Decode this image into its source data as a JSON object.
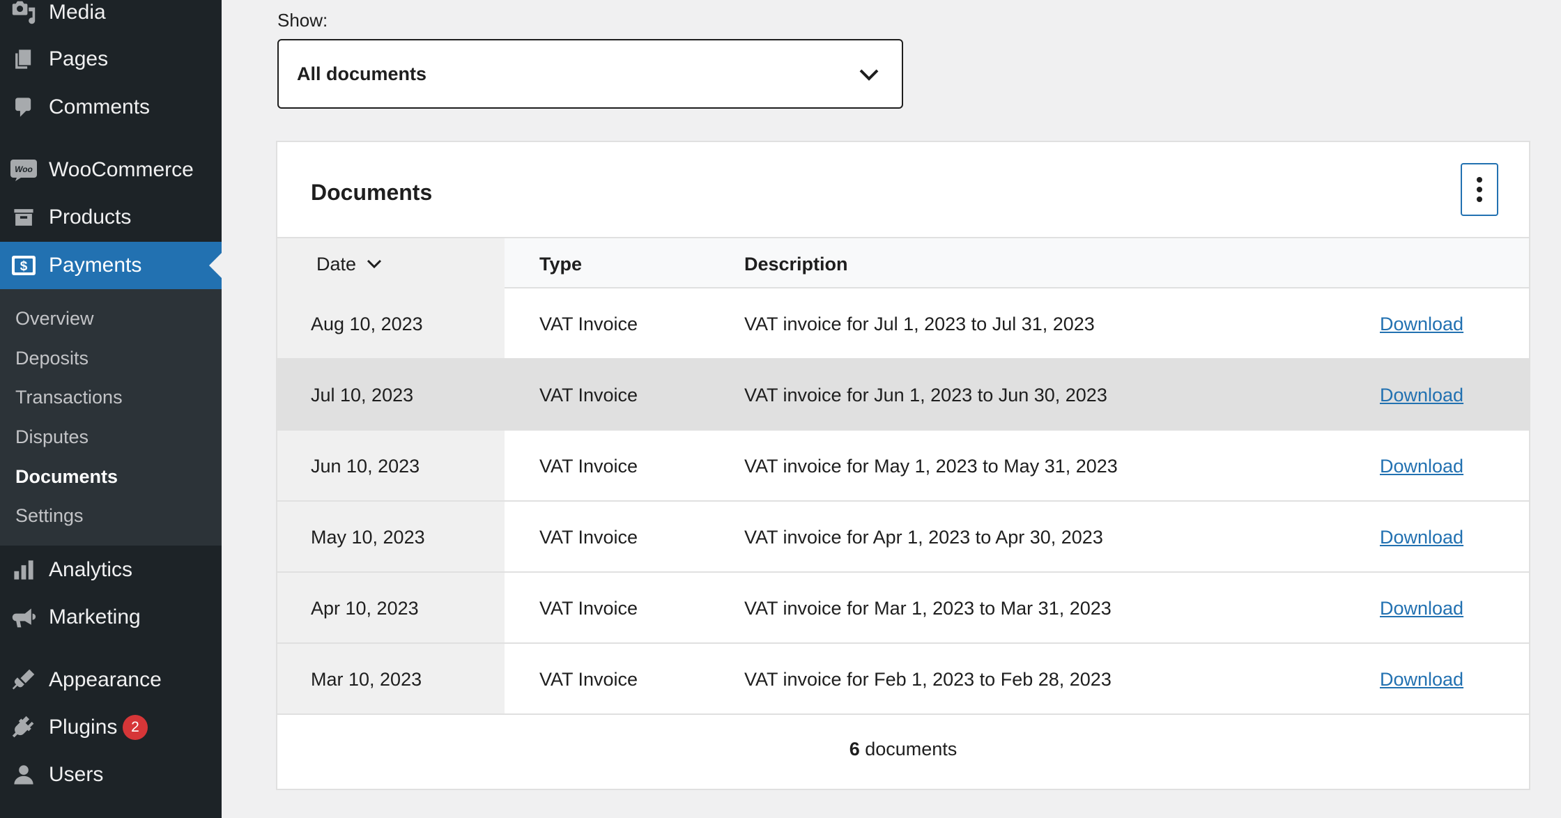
{
  "sidebar": {
    "top_items": [
      {
        "label": "Media",
        "icon": "media-icon"
      },
      {
        "label": "Pages",
        "icon": "pages-icon"
      },
      {
        "label": "Comments",
        "icon": "comments-icon"
      },
      {
        "label": "WooCommerce",
        "icon": "woocommerce-icon"
      },
      {
        "label": "Products",
        "icon": "products-icon"
      },
      {
        "label": "Payments",
        "icon": "payments-icon"
      }
    ],
    "submenu": [
      "Overview",
      "Deposits",
      "Transactions",
      "Disputes",
      "Documents",
      "Settings"
    ],
    "current_submenu": "Documents",
    "bottom_items": [
      {
        "label": "Analytics",
        "icon": "analytics-icon"
      },
      {
        "label": "Marketing",
        "icon": "marketing-icon"
      },
      {
        "label": "Appearance",
        "icon": "appearance-icon"
      },
      {
        "label": "Plugins",
        "icon": "plugins-icon",
        "badge": "2"
      },
      {
        "label": "Users",
        "icon": "users-icon"
      }
    ]
  },
  "filter": {
    "label": "Show:",
    "selected": "All documents"
  },
  "documents": {
    "title": "Documents",
    "columns": {
      "date": "Date",
      "type": "Type",
      "description": "Description"
    },
    "rows": [
      {
        "date": "Aug 10, 2023",
        "type": "VAT Invoice",
        "description": "VAT invoice for Jul 1, 2023 to Jul 31, 2023",
        "action": "Download"
      },
      {
        "date": "Jul 10, 2023",
        "type": "VAT Invoice",
        "description": "VAT invoice for Jun 1, 2023 to Jun 30, 2023",
        "action": "Download"
      },
      {
        "date": "Jun 10, 2023",
        "type": "VAT Invoice",
        "description": "VAT invoice for May 1, 2023 to May 31, 2023",
        "action": "Download"
      },
      {
        "date": "May 10, 2023",
        "type": "VAT Invoice",
        "description": "VAT invoice for Apr 1, 2023 to Apr 30, 2023",
        "action": "Download"
      },
      {
        "date": "Apr 10, 2023",
        "type": "VAT Invoice",
        "description": "VAT invoice for Mar 1, 2023 to Mar 31, 2023",
        "action": "Download"
      },
      {
        "date": "Mar 10, 2023",
        "type": "VAT Invoice",
        "description": "VAT invoice for Feb 1, 2023 to Feb 28, 2023",
        "action": "Download"
      }
    ],
    "footer_count": "6",
    "footer_label": "documents"
  },
  "colors": {
    "sidebar_bg": "#1d2327",
    "submenu_bg": "#2c3338",
    "accent": "#2271b1",
    "badge": "#d63638"
  }
}
